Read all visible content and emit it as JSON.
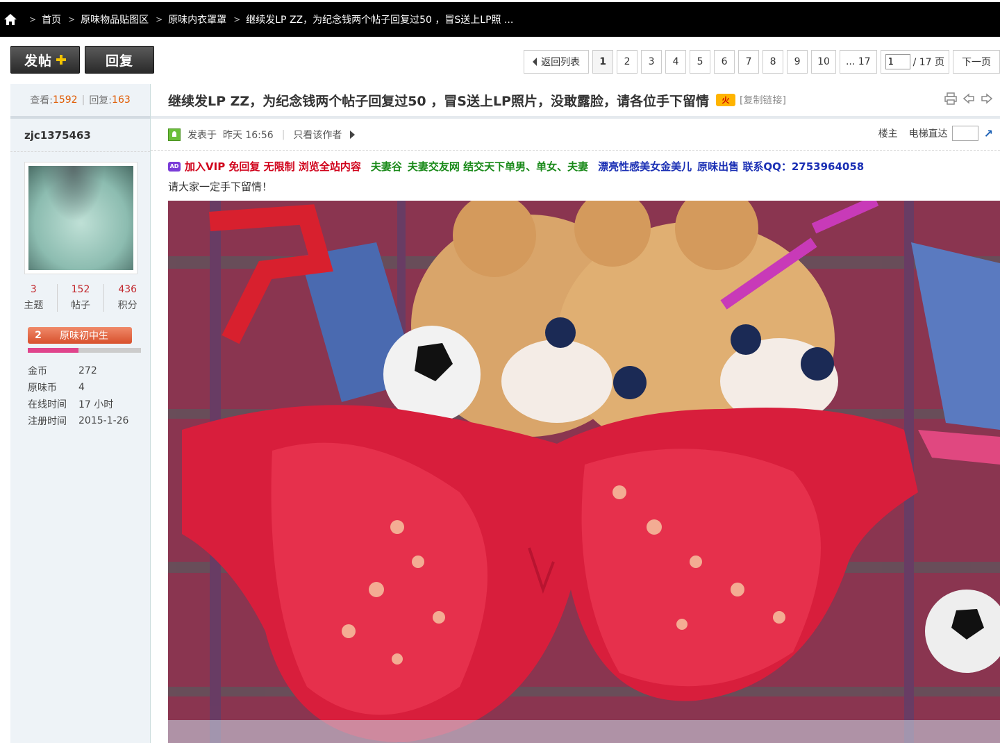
{
  "breadcrumb": {
    "items": [
      "首页",
      "原味物品贴图区",
      "原味内衣罩罩",
      "继续发LP ZZ，为纪念钱两个帖子回复过50 ，冒S送上LP照 ..."
    ]
  },
  "actions": {
    "post_label": "发帖",
    "reply_label": "回复"
  },
  "pager": {
    "back_label": "返回列表",
    "pages": [
      "1",
      "2",
      "3",
      "4",
      "5",
      "6",
      "7",
      "8",
      "9",
      "10"
    ],
    "last_page": "... 17",
    "current_value": "1",
    "total_label": "/ 17 页",
    "next_label": "下一页"
  },
  "stats": {
    "views_label": "查看:",
    "views": "1592",
    "replies_label": "回复:",
    "replies": "163"
  },
  "user": {
    "name": "zjc1375463",
    "counts": [
      {
        "value": "3",
        "label": "主题"
      },
      {
        "value": "152",
        "label": "帖子"
      },
      {
        "value": "436",
        "label": "积分"
      }
    ],
    "rank_level": "2",
    "rank_name": "原味初中生",
    "rank_progress": 0.45,
    "info": [
      {
        "k": "金币",
        "v": "272"
      },
      {
        "k": "原味币",
        "v": "4"
      },
      {
        "k": "在线时间",
        "v": "17 小时"
      },
      {
        "k": "注册时间",
        "v": "2015-1-26"
      }
    ]
  },
  "post": {
    "title": "继续发LP ZZ，为纪念钱两个帖子回复过50 ，冒S送上LP照片，没敢露脸，请各位手下留情",
    "hot_badge": "火",
    "copy_link": "[复制链接]",
    "posted_label": "发表于",
    "posted_time": "昨天 16:56",
    "only_author": "只看该作者",
    "floor_label": "楼主",
    "elevator_label": "电梯直达",
    "ad_tag": "AD",
    "ad": {
      "red": "加入VIP 免回复  无限制  浏览全站内容",
      "green1": "夫妻谷",
      "green2": "夫妻交友网  结交天下单男、单女、夫妻",
      "blue1": "漂亮性感美女金美儿",
      "blue2": "原味出售  联系QQ：2753964058"
    },
    "body": "请大家一定手下留情！"
  },
  "colors": {
    "topbar_bg": "#000000",
    "accent_orange": "#e05a00",
    "count_red": "#c2282d",
    "ad_red": "#d0021b",
    "ad_green": "#1a8a1a",
    "ad_blue": "#1a2fb4"
  }
}
